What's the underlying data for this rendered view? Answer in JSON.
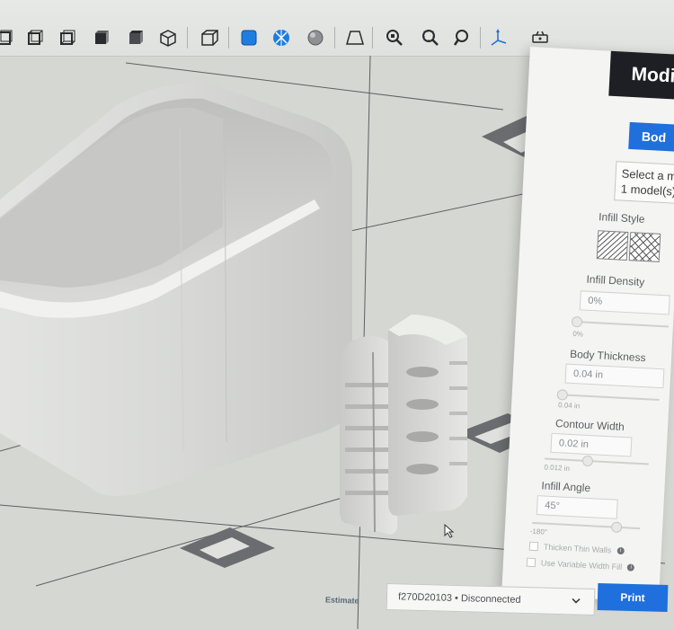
{
  "toolbar": {
    "buttons": [
      {
        "name": "view-cube-front-icon"
      },
      {
        "name": "view-cube-back-icon"
      },
      {
        "name": "view-cube-left-icon"
      },
      {
        "name": "view-cube-right-icon"
      },
      {
        "name": "view-cube-top-icon"
      },
      {
        "name": "view-cube-iso-icon"
      },
      {
        "name": "view-perspective-icon"
      },
      {
        "name": "shaded-view-icon"
      },
      {
        "name": "xray-view-icon"
      },
      {
        "name": "sphere-view-icon"
      },
      {
        "name": "plate-view-icon"
      },
      {
        "name": "zoom-selection-icon"
      },
      {
        "name": "zoom-all-icon"
      },
      {
        "name": "zoom-icon"
      },
      {
        "name": "axes-icon"
      },
      {
        "name": "settings-printer-icon"
      }
    ]
  },
  "panel": {
    "title": "Modi",
    "blue_button_label": "Bod",
    "select_note_line1": "Select a m",
    "select_note_line2": "1 model(s)",
    "infill_style_label": "Infill Style",
    "infill_density_label": "Infill Density",
    "infill_density_value": "0%",
    "infill_density_min": "0%",
    "body_thickness_label": "Body Thickness",
    "body_thickness_value": "0.04 in",
    "body_thickness_min": "0.04 in",
    "contour_width_label": "Contour Width",
    "contour_width_value": "0.02 in",
    "contour_width_min": "0.012 in",
    "infill_angle_label": "Infill Angle",
    "infill_angle_value": "45°",
    "infill_angle_min": "-180°",
    "thicken_thin_walls_label": "Thicken Thin Walls",
    "variable_width_label": "Use Variable Width Fill"
  },
  "footer": {
    "estimate_label": "Estimate",
    "printer_status": "f270D20103 • Disconnected",
    "print_label": "Print"
  },
  "colors": {
    "accent": "#1f6fdc",
    "header": "#1e1f24",
    "canvas": "#d5d7d2"
  }
}
